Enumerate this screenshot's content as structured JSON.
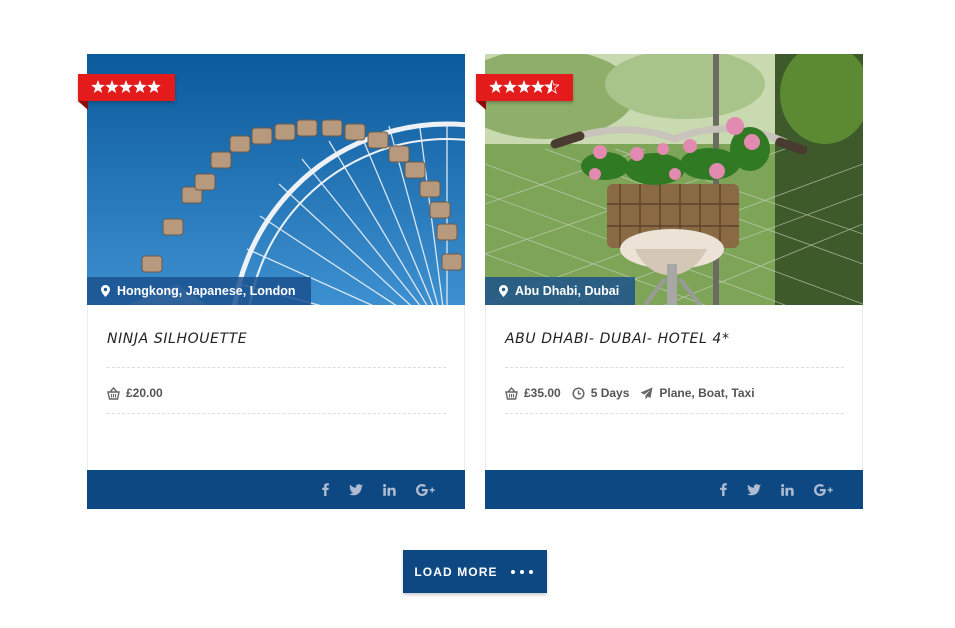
{
  "cards": [
    {
      "rating": 5,
      "location": "Hongkong, Japanese, London",
      "title": "Ninja Silhouette",
      "price": "£20.00",
      "duration": "",
      "transport": ""
    },
    {
      "rating": 4.5,
      "location": "Abu Dhabi, Dubai",
      "title": "Abu Dhabi- Dubai- Hotel 4*",
      "price": "£35.00",
      "duration": "5 Days",
      "transport": "Plane, Boat, Taxi"
    }
  ],
  "social_icons": [
    "facebook-icon",
    "twitter-icon",
    "linkedin-icon",
    "google-plus-icon"
  ],
  "load_more": {
    "label": "LOAD MORE"
  },
  "colors": {
    "primary": "#0e4882",
    "ribbon": "#e31b1b",
    "location_bar": "#184e8c"
  }
}
